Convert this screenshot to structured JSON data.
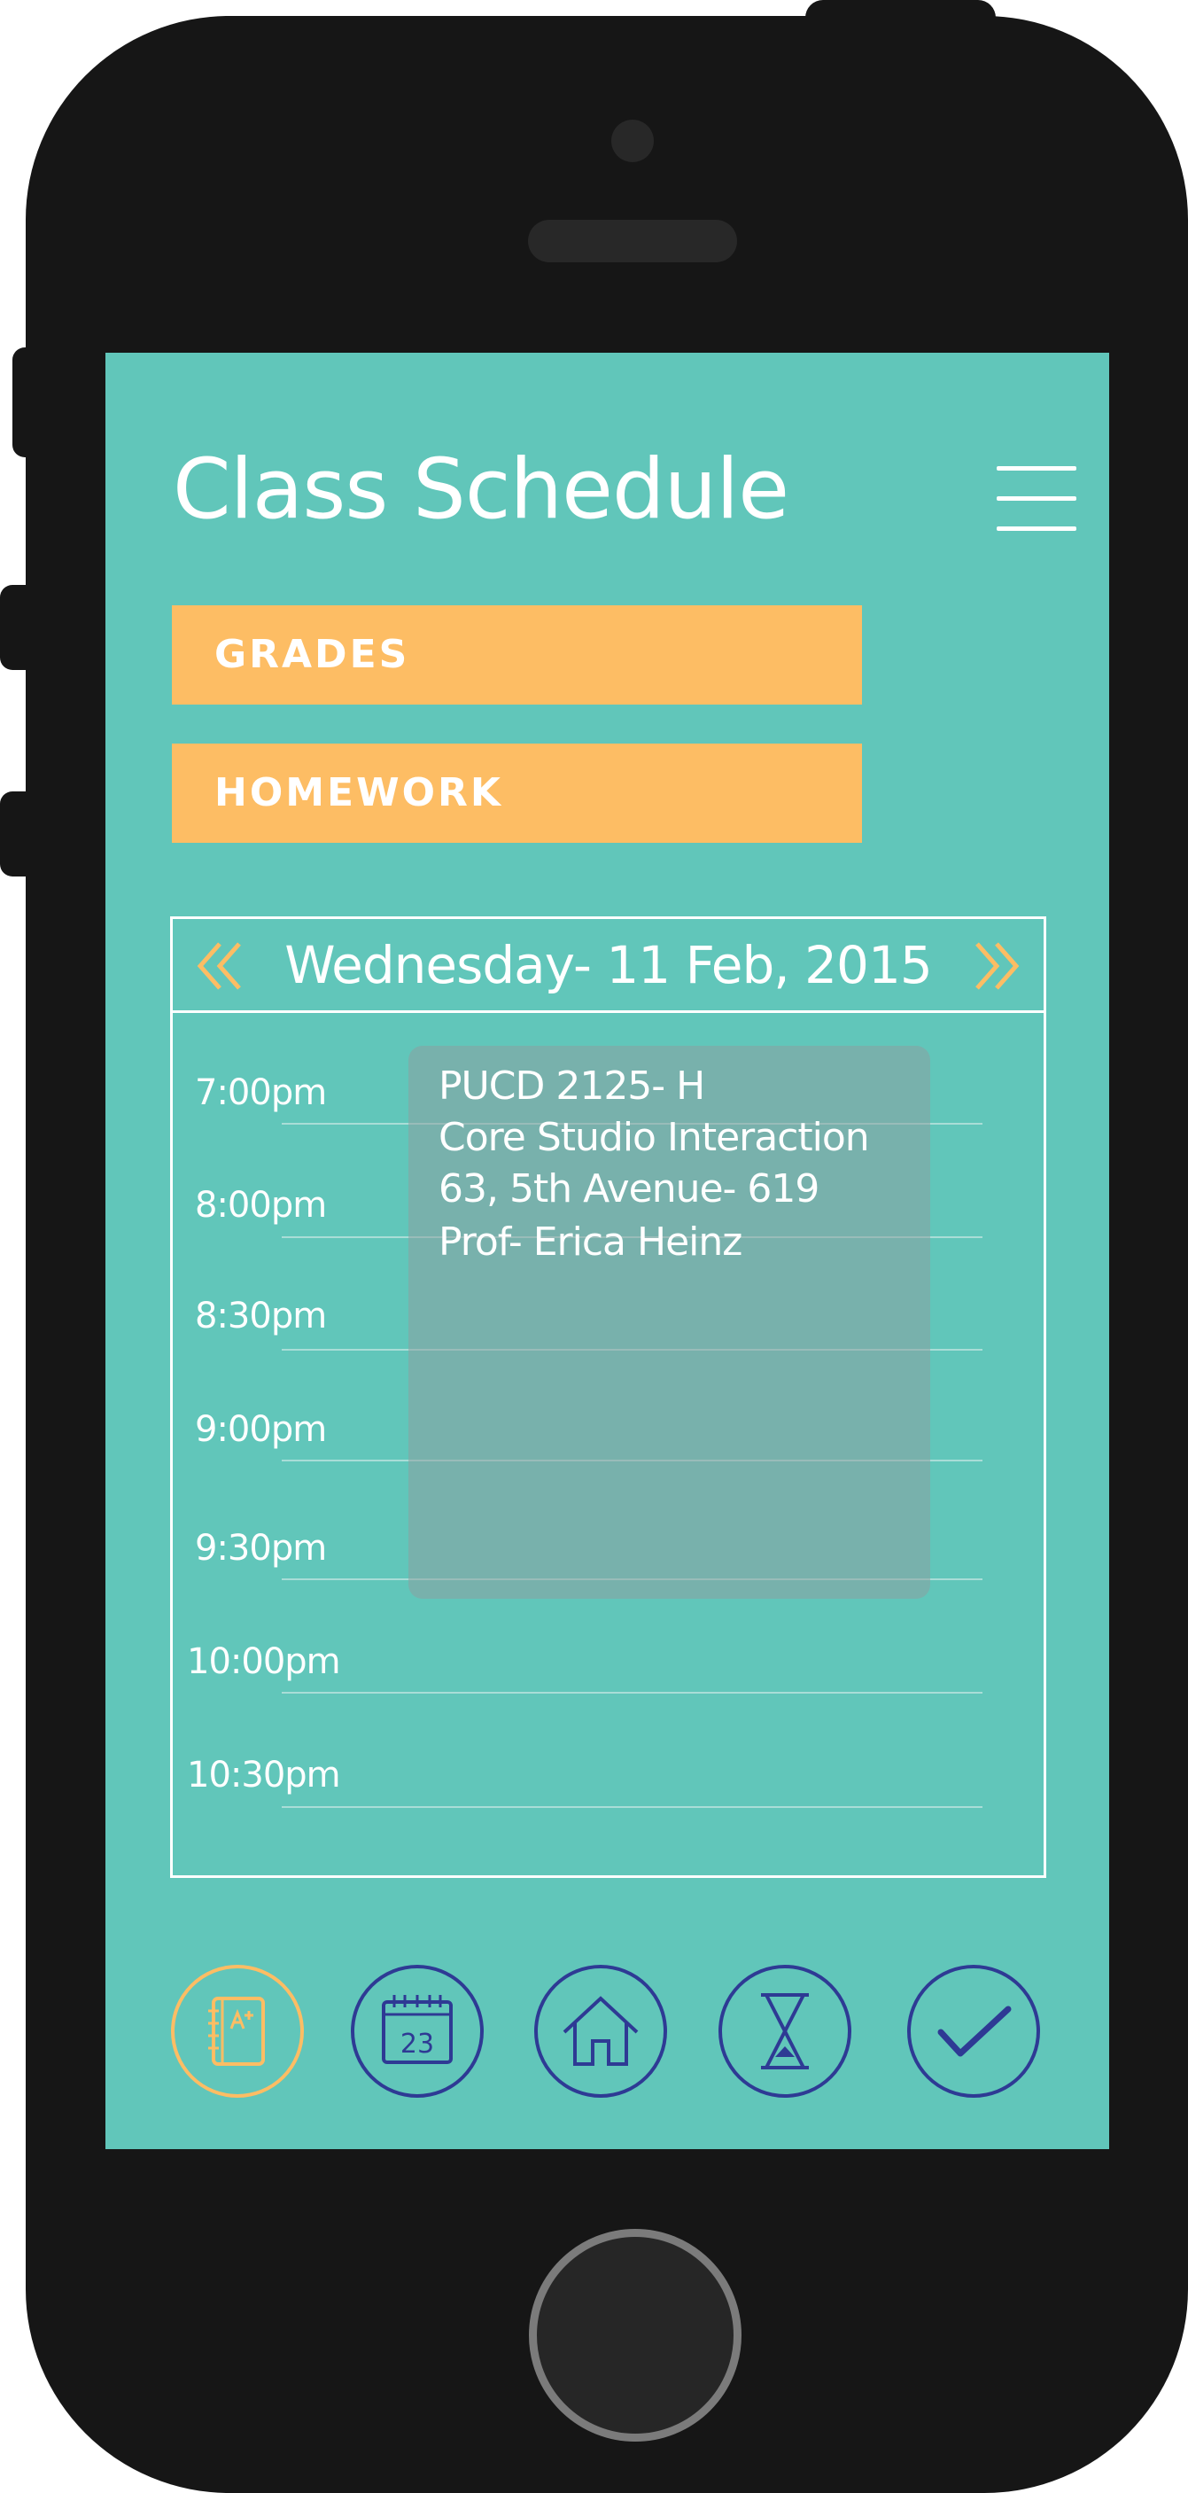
{
  "header": {
    "title": "Class Schedule"
  },
  "nav": {
    "grades_label": "GRADES",
    "homework_label": "HOMEWORK"
  },
  "schedule": {
    "date": "Wednesday- 11 Feb, 2015",
    "times": [
      "7:00pm",
      "8:00pm",
      "8:30pm",
      "9:00pm",
      "9:30pm",
      "10:00pm",
      "10:30pm"
    ],
    "event": {
      "code": "PUCD 2125- H",
      "name": "Core Studio Interaction",
      "location": "63, 5th Avenue- 619",
      "professor": "Prof- Erica Heinz"
    }
  },
  "tabbar": {
    "calendar_day": "23",
    "items": [
      "grades-notebook-icon",
      "calendar-icon",
      "home-icon",
      "hourglass-icon",
      "checkmark-icon"
    ]
  },
  "colors": {
    "screen_bg": "#61c6ba",
    "accent": "#fdbd64",
    "icon_stroke": "#2e3a94",
    "phone_body": "#161616"
  }
}
